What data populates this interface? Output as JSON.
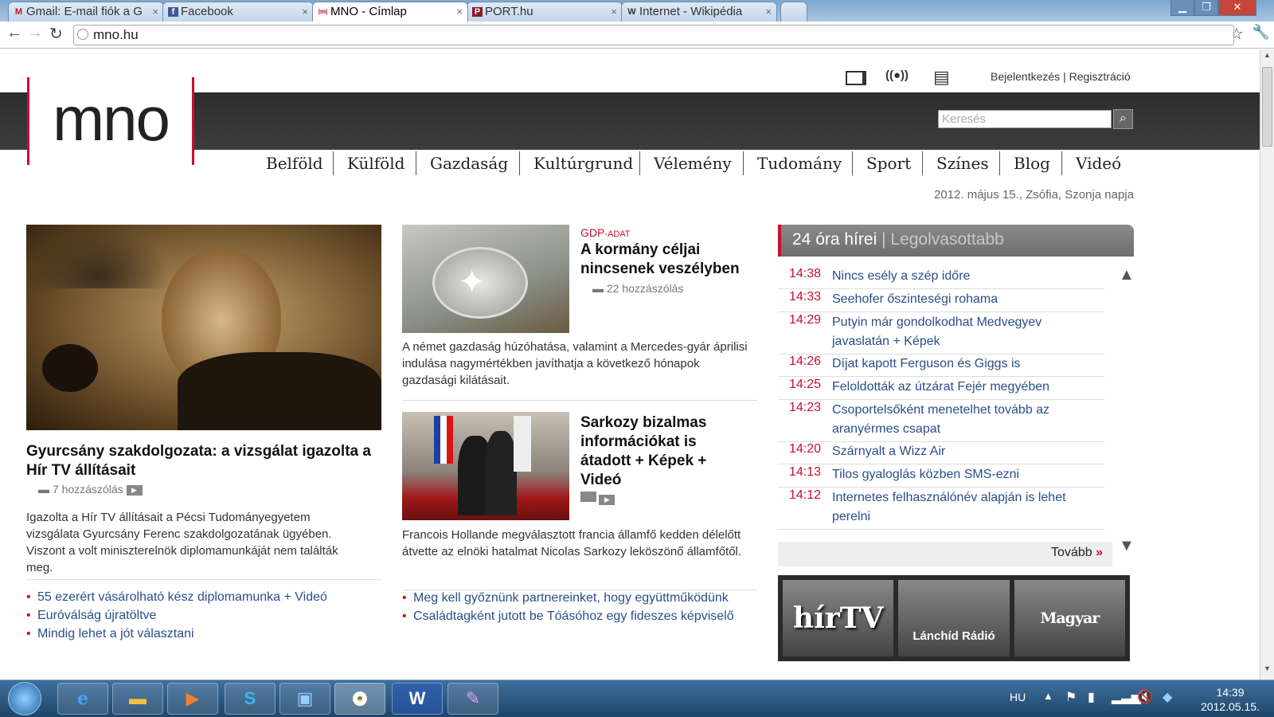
{
  "browser": {
    "tabs": [
      {
        "label": "Gmail: E-mail fiók a G",
        "icon": "gmail-icon",
        "fav": "M",
        "active": false
      },
      {
        "label": "Facebook",
        "icon": "facebook-icon",
        "fav": "f",
        "active": false
      },
      {
        "label": "MNO - Címlap",
        "icon": "mno-icon",
        "fav": "|m|",
        "active": true
      },
      {
        "label": "PORT.hu",
        "icon": "port-icon",
        "fav": "P",
        "active": false
      },
      {
        "label": "Internet - Wikipédia",
        "icon": "wikipedia-icon",
        "fav": "W",
        "active": false
      }
    ],
    "url": "mno.hu"
  },
  "header": {
    "logo": "mno",
    "login": "Bejelentkezés",
    "separator": "|",
    "register": "Regisztráció",
    "search_placeholder": "Keresés",
    "date_line": "2012. május 15., Zsófia, Szonja napja"
  },
  "nav": [
    "Belföld",
    "Külföld",
    "Gazdaság",
    "Kultúrgrund",
    "Vélemény",
    "Tudomány",
    "Sport",
    "Színes",
    "Blog",
    "Videó"
  ],
  "lead": {
    "headline": "Gyurcsány szakdolgozata: a vizsgálat igazolta a Hír TV állításait",
    "comments": "7 hozzászólás",
    "body": "Igazolta a Hír TV állításait a Pécsi Tudományegyetem vizsgálata Gyurcsány Ferenc szakdolgozatának ügyében. Viszont a volt miniszterelnök diplomamunkáját nem találták meg.",
    "links": [
      "55 ezerért vásárolható kész diplomamunka + Videó",
      "Euróválság újratöltve",
      "Mindig lehet a jót választani"
    ]
  },
  "mid": {
    "a1_kicker": "GDP",
    "a1_kicker_sub": "-ADAT",
    "a1_title": "A kormány céljai nincsenek veszélyben",
    "a1_comments": "22 hozzászólás",
    "a1_body": "A német gazdaság húzóhatása, valamint a Mercedes-gyár áprilisi indulása nagymértékben javíthatja a következő hónapok gazdasági kilátásait.",
    "a2_title": "Sarkozy bizalmas információkat is átadott + Képek + Videó",
    "a2_body": "Francois Hollande megválasztott francia államfő kedden délelőtt átvette az elnöki hatalmat Nicolas Sarkozy leköszönő államfőtől.",
    "links": [
      "Meg kell győznünk partnereinket, hogy együttműködünk",
      "Családtagként jutott be Tóásóhoz egy fideszes képviselő"
    ]
  },
  "right": {
    "tab_active": "24 óra hírei",
    "tab_sep": "|",
    "tab_inactive": "Legolvasottabb",
    "news": [
      {
        "time": "14:38",
        "title": "Nincs esély a szép időre"
      },
      {
        "time": "14:33",
        "title": "Seehofer őszinteségi rohama"
      },
      {
        "time": "14:29",
        "title": "Putyin már gondolkodhat Medvegyev javaslatán + Képek"
      },
      {
        "time": "14:26",
        "title": "Díjat kapott Ferguson és Giggs is"
      },
      {
        "time": "14:25",
        "title": "Feloldották az útzárat Fejér megyében"
      },
      {
        "time": "14:23",
        "title": "Csoportelsőként menetelhet tovább az aranyérmes csapat"
      },
      {
        "time": "14:20",
        "title": "Szárnyalt a Wizz Air"
      },
      {
        "time": "14:13",
        "title": "Tilos gyaloglás közben SMS-ezni"
      },
      {
        "time": "14:12",
        "title": "Internetes felhasználónév alapján is lehet perelni"
      }
    ],
    "more": "Tovább",
    "partners": [
      "hírTV",
      "Lánchíd Rádió",
      "Magyar Nemzet"
    ]
  },
  "taskbar": {
    "lang": "HU",
    "time": "14:39",
    "date": "2012.05.15."
  },
  "colors": {
    "accent": "#c8102e",
    "link": "#2a4e8a",
    "band": "#333333"
  }
}
